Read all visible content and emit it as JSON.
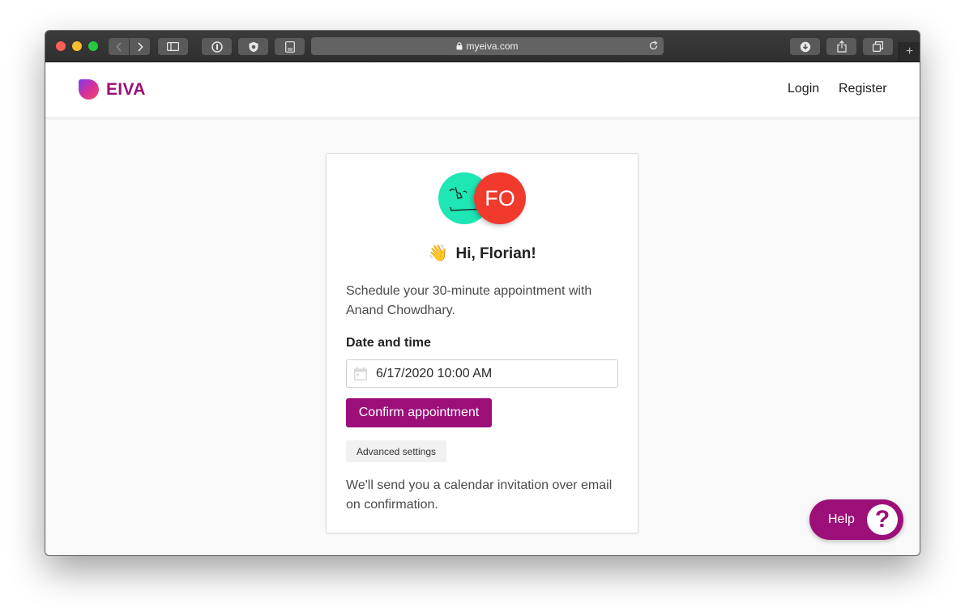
{
  "browser": {
    "url": "myeiva.com",
    "icons": [
      "back-icon",
      "forward-icon",
      "sidebar-icon",
      "password-manager-icon",
      "extension-icon",
      "reader-icon",
      "lock-icon",
      "reload-icon",
      "download-icon",
      "share-icon",
      "tabs-icon",
      "new-tab-icon"
    ]
  },
  "header": {
    "brand": "EIVA",
    "login": "Login",
    "register": "Register"
  },
  "card": {
    "user_initials": "FO",
    "greeting_emoji": "👋",
    "greeting": "Hi, Florian!",
    "description": "Schedule your 30-minute appointment with Anand Chowdhary.",
    "date_label": "Date and time",
    "date_value": "6/17/2020 10:00 AM",
    "confirm_label": "Confirm appointment",
    "advanced_label": "Advanced settings",
    "footer_note": "We'll send you a calendar invitation over email on confirmation."
  },
  "help": {
    "label": "Help",
    "icon": "?"
  },
  "colors": {
    "brand": "#9c0f79",
    "avatar_host": "#1ee6b4",
    "avatar_user": "#ef3a2c"
  }
}
